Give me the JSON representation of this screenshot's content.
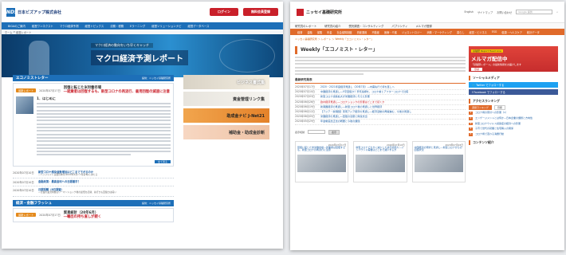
{
  "left": {
    "logo_mark": "NDS",
    "logo_text": "日本ビズアップ株式会社",
    "top_buttons": [
      "ログイン",
      "無料会員登録"
    ],
    "nav": [
      "BIGAのご案内",
      "経営ワンネクスト",
      "マクロ経済予測",
      "経営トピックス",
      "法務・税務",
      "Eラーニング",
      "経営ソリューションナビ",
      "経営データベース"
    ],
    "sub_nav": [
      "ホーム",
      "経営レポート"
    ],
    "banner": {
      "subtitle": "マクロ経済の動向をいち早くキャッチ",
      "title": "マクロ経済予測レポート"
    },
    "section1": {
      "title": "エコノミストレター",
      "source": "提供：ニッセイ基礎研究所"
    },
    "feature": {
      "tag": "最新レポート",
      "date": "2020年07月17日",
      "title_l1": "回復に転じた米労働市場",
      "title_l2": "―就業者は回復するも、新型コロナの再流行、雇用回復の減速に注意",
      "heading": "1．はじめに",
      "more": "全て見る"
    },
    "news": [
      {
        "date": "2020年07月10日",
        "title": "新型コロナ感染者数増加はどこまで下がるのか",
        "desc": "―ヘッジレイト主要月末付(2020年2月〜7月初旬)にあたる"
      },
      {
        "date": "2020年07月10日",
        "title": "金融政策：最高金利への日銀着手？",
        "desc": ""
      },
      {
        "date": "2020年07月10日",
        "title": "日銀短観（6月調査）",
        "desc": "―企業の業況判断はリーマンショック後の最低を記録、先行きも回復力は鈍い"
      }
    ],
    "section2": {
      "title": "経済・金融フラッシュ",
      "source": "提供：ニッセイ基礎研究所"
    },
    "feature2": {
      "tag": "最新レポート",
      "date": "2020年07月17日",
      "title_l1": "貿易統計（20年6月）",
      "title_l2": "―輸出の持ち直しが続く"
    },
    "side": [
      "ビジネス書式集",
      "資金管理リンク集",
      "助成金ナビ J-Net21",
      "補助金・助成金診断"
    ]
  },
  "right": {
    "logo_text": "ニッセイ基礎研究所",
    "top_links": [
      "English",
      "サイトマップ",
      "お問い合わせ"
    ],
    "search_placeholder": "Google 提供",
    "nav1": [
      "研究員のレポート",
      "研究員の紹介",
      "受託調査・コンサルティング",
      "パブリシティ",
      "メルマガ登録"
    ],
    "nav2": [
      "経済",
      "金融",
      "保険",
      "年金",
      "社会保障制度",
      "資産運用",
      "不動産",
      "医療・介護",
      "ジェロントロジー",
      "消費・マーケティング",
      "暮らし",
      "経営・ビジネス",
      "ESG",
      "健康・ヘルスケア",
      "統計データ"
    ],
    "breadcrumb": "ニッセイ基礎研究所 ＞ レポート ＞ Weekly「エコノミスト・レター」",
    "title": "Weekly「エコノミスト・レター」",
    "recent_title": "最新研究発表",
    "recent": [
      {
        "date": "2020年07月17日",
        "title": "2020・2021年度経済見通し（20年7月）―内需先行で持ち直しへ",
        "red": false
      },
      {
        "date": "2020年07月10日",
        "title": "中国経済の見通し―V字回復か？景気指標を、コロナ前とアフターコロナで比較",
        "red": false
      },
      {
        "date": "2020年07月03日",
        "title": "新型コロナ感染拡大が米国経済に与えた影響",
        "red": false
      },
      {
        "date": "2020年06月26日",
        "title": "欧州経済見通し―コロナショックの影響はどこまで続くか",
        "red": true
      },
      {
        "date": "2020年06月19日",
        "title": "新興国経済の見通し―新型コロナ後の見通しと世界経済",
        "red": false
      },
      {
        "date": "2020年06月12日",
        "title": "【アジア・新興国】東南アジア経済の見通し―経済活動の再開進む、今後の見通し",
        "red": false
      },
      {
        "date": "2020年06月05日",
        "title": "米国経済の見通し―回復の道筋と財政支出",
        "red": false
      },
      {
        "date": "2020年05月29日",
        "title": "年金制度改正法の概要と今後の課題",
        "red": false
      }
    ],
    "select_label": "表示切替",
    "select_btn": "表示",
    "cards": [
      {
        "date": "2020年07月17日",
        "title": "回復に転じた米労働市場―就業者は回復するも、新型コロナの再流行に注意"
      },
      {
        "date": "2020年07月10日",
        "title": "新型コロナで大きく減少した訪日外国人―インバウンド需要はどこまで減少するか"
      },
      {
        "date": "2020年07月03日",
        "title": "中国経済の現状と見通し―新型コロナからの回復状況"
      }
    ],
    "ad": {
      "badge": "基礎研 Report Head Line",
      "title": "メルマガ配信中",
      "desc": "「基礎研レポート」の最新情報をお届けします",
      "btn": "登録"
    },
    "social_title": "ソーシャルメディア",
    "social": [
      {
        "label": "Twitter でフォローする",
        "color": "#1da1f2"
      },
      {
        "label": "Facebook でフォローする",
        "color": "#3b5998"
      }
    ],
    "rank_title": "アクセスランキング",
    "rank_tabs": [
      "週間ランキング",
      "月間"
    ],
    "ranks": [
      "コロナ禍の家計への影響（1）",
      "エンゲージメントとは何か―日本企業の課題と方向性",
      "新型コロナウイルス感染症の経済への影響",
      "子育て世代の就業と住宅購入の関係",
      "コロナ禍で変わる消費行動"
    ],
    "content_title": "コンテンツ紹介"
  }
}
